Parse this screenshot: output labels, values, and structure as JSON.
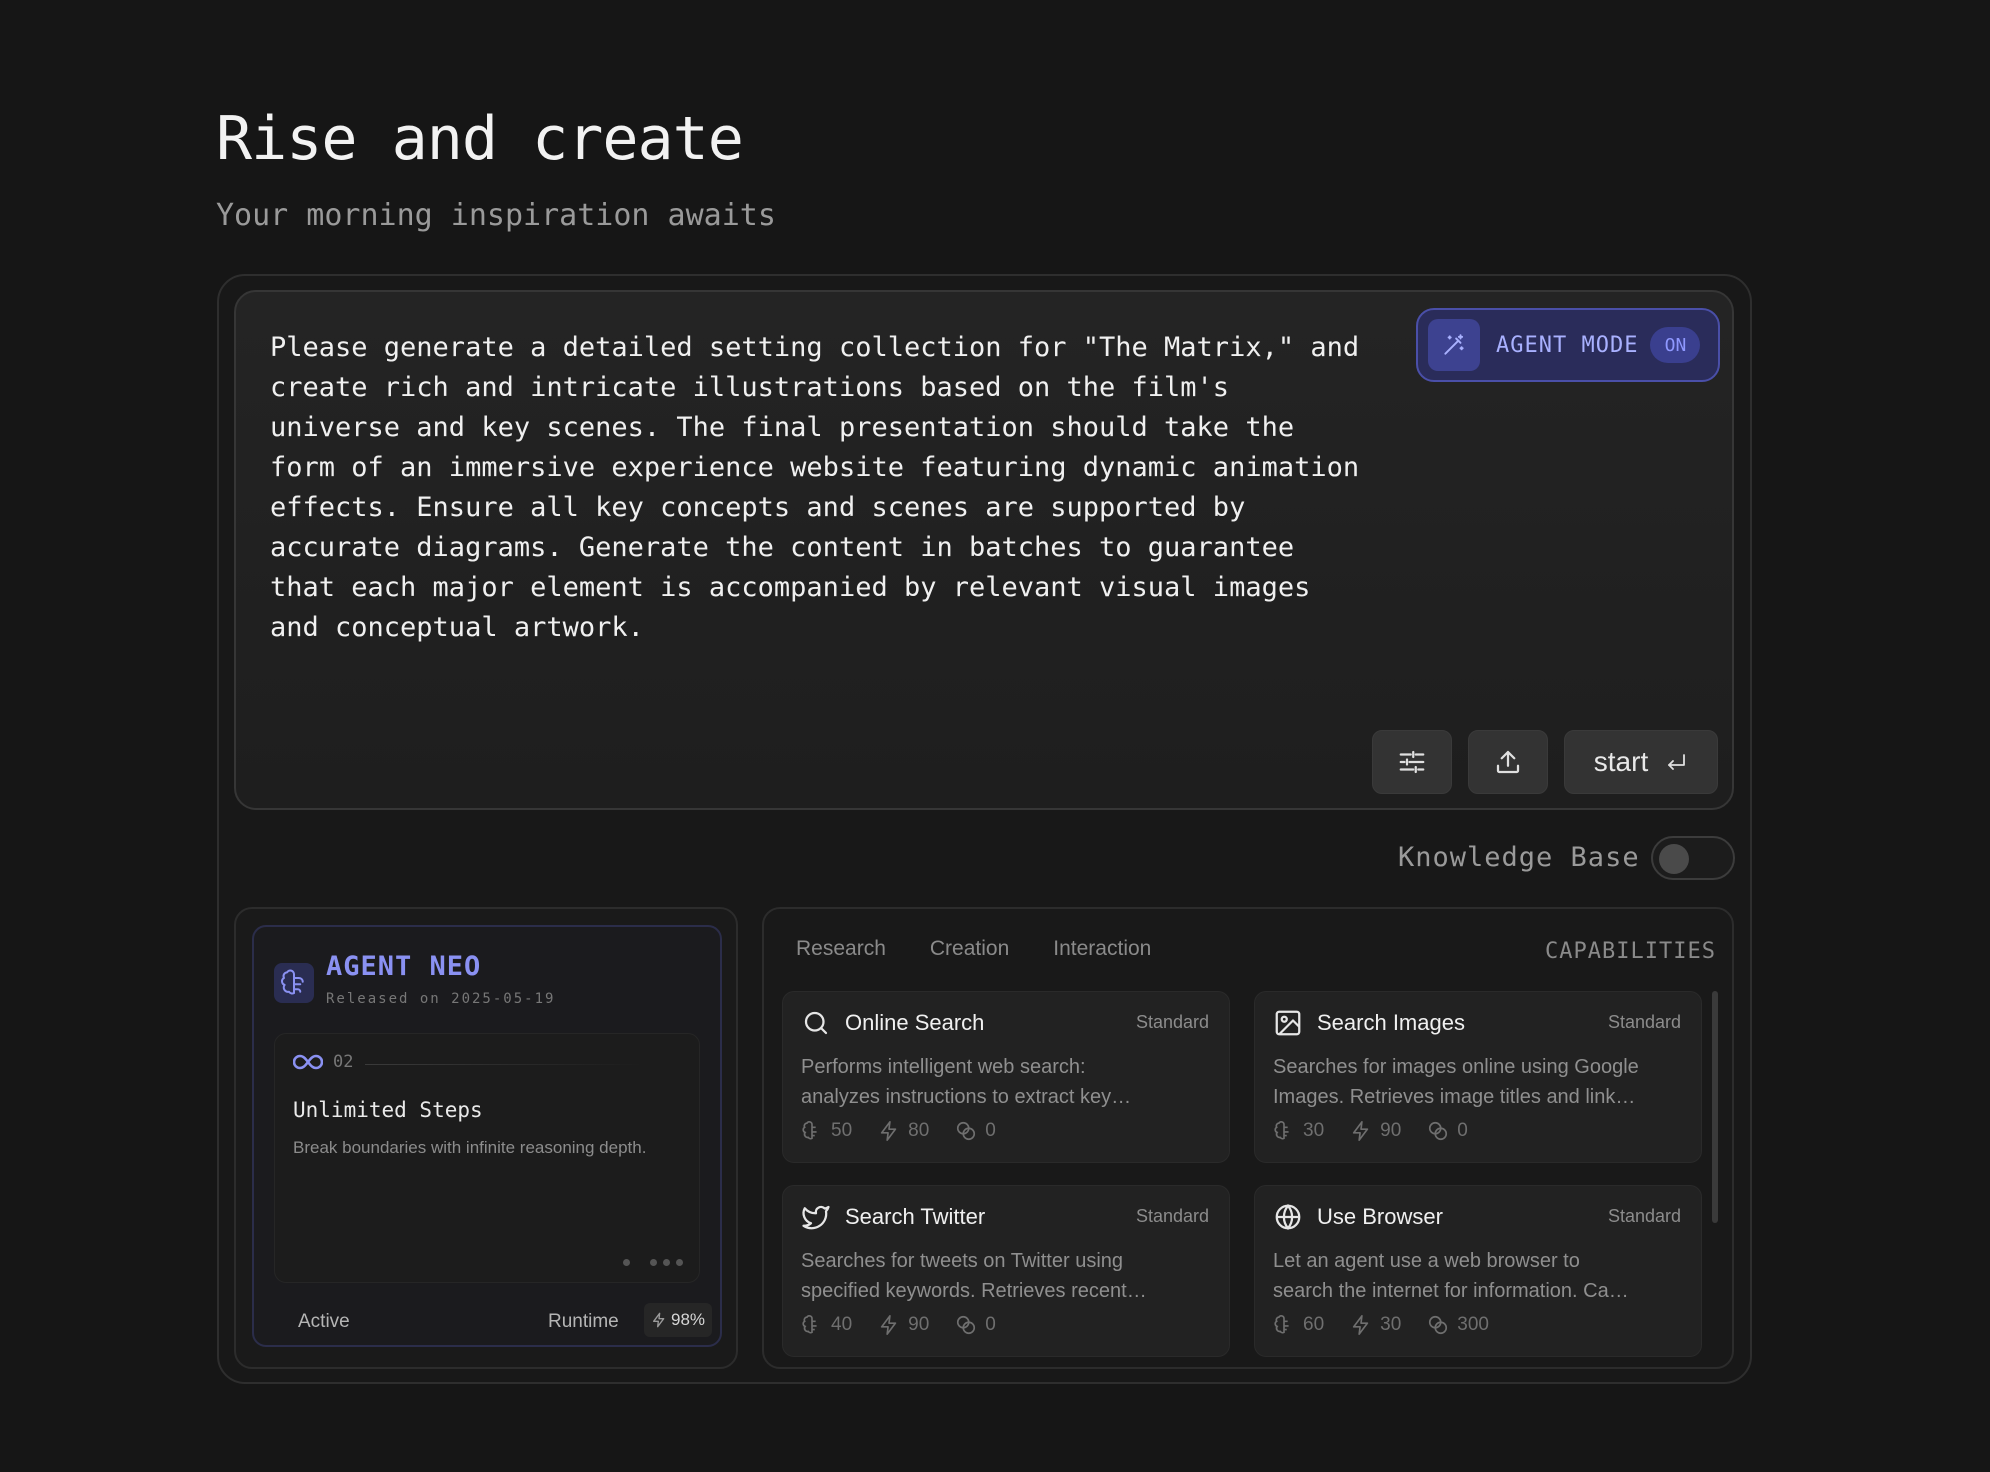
{
  "header": {
    "title": "Rise and create",
    "subtitle": "Your morning inspiration awaits"
  },
  "prompt": {
    "text": "Please generate a detailed setting collection for \"The Matrix,\" and\ncreate rich and intricate illustrations based on the film's\nuniverse and key scenes. The final presentation should take the\nform of an immersive experience website featuring dynamic animation\neffects. Ensure all key concepts and scenes are supported by\naccurate diagrams. Generate the content in batches to guarantee\nthat each major element is accompanied by relevant visual images\nand conceptual artwork."
  },
  "agent_mode": {
    "label": "AGENT MODE",
    "state": "ON",
    "icon": "magic-wand-icon"
  },
  "toolbar": {
    "settings_icon": "sliders-icon",
    "upload_icon": "upload-icon",
    "start_label": "start",
    "start_icon": "enter-key-icon"
  },
  "knowledge_base": {
    "label": "Knowledge Base",
    "enabled": false
  },
  "agent": {
    "name": "AGENT NEO",
    "released": "Released on 2025-05-19",
    "icon": "brain-icon",
    "feature": {
      "number": "02",
      "icon": "infinity-icon",
      "title": "Unlimited Steps",
      "description": "Break boundaries with infinite reasoning depth."
    },
    "status": "Active",
    "runtime_label": "Runtime",
    "runtime_value": "98%"
  },
  "capabilities": {
    "heading": "CAPABILITIES",
    "tabs": [
      "Research",
      "Creation",
      "Interaction"
    ],
    "items": [
      {
        "title": "Online Search",
        "tier": "Standard",
        "icon": "search-icon",
        "description": "Performs intelligent web search:\nanalyzes instructions to extract key…",
        "stats": [
          "50",
          "80",
          "0"
        ]
      },
      {
        "title": "Search Images",
        "tier": "Standard",
        "icon": "image-icon",
        "description": "Searches for images online using Google\nImages. Retrieves image titles and link…",
        "stats": [
          "30",
          "90",
          "0"
        ]
      },
      {
        "title": "Search Twitter",
        "tier": "Standard",
        "icon": "twitter-icon",
        "description": "Searches for tweets on Twitter using\nspecified keywords. Retrieves recent…",
        "stats": [
          "40",
          "90",
          "0"
        ]
      },
      {
        "title": "Use Browser",
        "tier": "Standard",
        "icon": "globe-icon",
        "description": "Let an agent use a web browser to\nsearch the internet for information. Ca…",
        "stats": [
          "60",
          "30",
          "300"
        ]
      }
    ]
  },
  "colors": {
    "background": "#161616",
    "accent": "#8a91f2",
    "agent_mode_bg": "#2a2c5a"
  }
}
